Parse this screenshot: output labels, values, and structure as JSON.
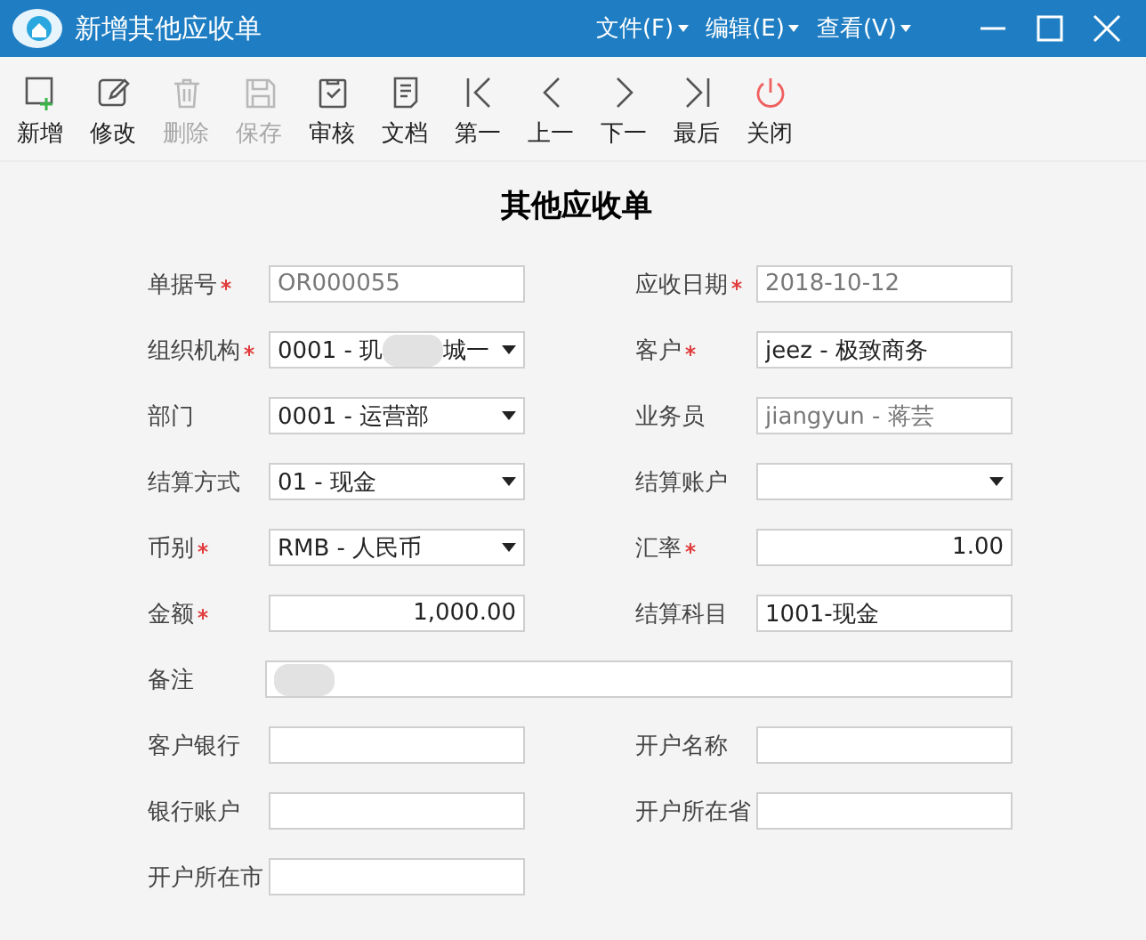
{
  "window": {
    "title": "新增其他应收单",
    "menus": [
      "文件(F)",
      "编辑(E)",
      "查看(V)"
    ]
  },
  "toolbar": [
    {
      "label": "新增",
      "disabled": false
    },
    {
      "label": "修改",
      "disabled": false
    },
    {
      "label": "删除",
      "disabled": true
    },
    {
      "label": "保存",
      "disabled": true
    },
    {
      "label": "审核",
      "disabled": false
    },
    {
      "label": "文档",
      "disabled": false
    },
    {
      "label": "第一",
      "disabled": false
    },
    {
      "label": "上一",
      "disabled": false
    },
    {
      "label": "下一",
      "disabled": false
    },
    {
      "label": "最后",
      "disabled": false
    },
    {
      "label": "关闭",
      "disabled": false
    }
  ],
  "form": {
    "title": "其他应收单",
    "rows": [
      {
        "fields": [
          {
            "label": "单据号",
            "required": true,
            "kind": "text",
            "value": "OR000055",
            "readonly": true
          },
          {
            "label": "应收日期",
            "required": true,
            "kind": "text",
            "value": "2018-10-12",
            "readonly": true
          }
        ]
      },
      {
        "fields": [
          {
            "label": "组织机构",
            "required": true,
            "kind": "select",
            "value": "0001 - 玑",
            "redacted": true,
            "value_end": "城一",
            "readonly": false
          },
          {
            "label": "客户",
            "required": true,
            "kind": "text",
            "value": "jeez  - 极致商务",
            "readonly": false
          }
        ]
      },
      {
        "fields": [
          {
            "label": "部门",
            "required": false,
            "kind": "select",
            "value": "0001 - 运营部",
            "readonly": false
          },
          {
            "label": "业务员",
            "required": false,
            "kind": "text",
            "value": "jiangyun  - 蒋芸",
            "readonly": true
          }
        ]
      },
      {
        "fields": [
          {
            "label": "结算方式",
            "required": false,
            "kind": "select",
            "value": "01 - 现金",
            "readonly": false
          },
          {
            "label": "结算账户",
            "required": false,
            "kind": "select"
          }
        ]
      },
      {
        "fields": [
          {
            "label": "币别",
            "required": true,
            "kind": "select",
            "value": "RMB - 人民币",
            "readonly": false
          },
          {
            "label": "汇率",
            "required": true,
            "kind": "number",
            "value": "1.00",
            "readonly": false
          }
        ]
      },
      {
        "fields": [
          {
            "label": "金额",
            "required": true,
            "kind": "number",
            "value": "1,000.00",
            "readonly": false
          },
          {
            "label": "结算科目",
            "required": false,
            "kind": "text",
            "value": "1001-现金",
            "readonly": false
          }
        ]
      },
      {
        "fields": [
          {
            "label": "备注",
            "required": false,
            "kind": "wide",
            "redacted": true
          }
        ]
      },
      {
        "fields": [
          {
            "label": "客户银行",
            "required": false,
            "kind": "text"
          },
          {
            "label": "开户名称",
            "required": false,
            "kind": "text"
          }
        ]
      },
      {
        "fields": [
          {
            "label": "银行账户",
            "required": false,
            "kind": "text"
          },
          {
            "label": "开户所在省",
            "required": false,
            "kind": "text"
          }
        ]
      },
      {
        "fields": [
          {
            "label": "开户所在市",
            "required": false,
            "kind": "text"
          }
        ]
      }
    ]
  }
}
